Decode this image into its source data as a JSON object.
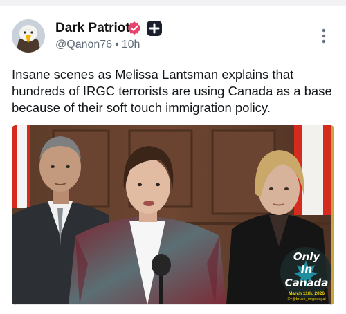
{
  "post": {
    "author_name": "Dark Patriot",
    "handle": "@Qanon76",
    "separator": "•",
    "time": "10h",
    "text": "Insane scenes as Melissa Lantsman explains that hundreds of IRGC terrorists are using Canada as a base because of their soft touch immigration policy."
  },
  "media": {
    "watermark": {
      "line1": "Only",
      "line2": "In",
      "line3": "Canada",
      "date": "March 11th, 2026",
      "credit": "X=@bruce_mrgoodgal"
    }
  },
  "colors": {
    "verified_badge": "#e8436b",
    "plus_badge": "#1a1f2e",
    "meta_text": "#5f6b76",
    "watermark_yellow": "#f2d600"
  },
  "icons": {
    "verified": "verified-badge-icon",
    "plus": "plus-badge-icon",
    "more": "more-vertical-icon"
  }
}
